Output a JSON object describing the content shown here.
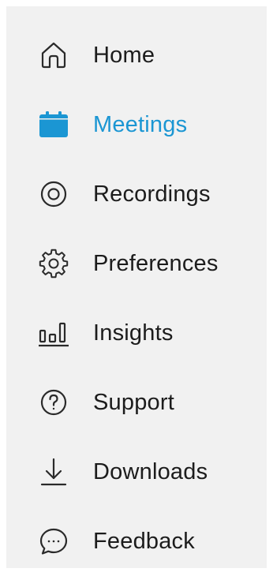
{
  "colors": {
    "active": "#1b96d3",
    "text": "#1c1c1c",
    "sidebar_bg": "#f1f1f1"
  },
  "sidebar": {
    "active_item": "Meetings",
    "items": [
      {
        "label": "Home",
        "icon": "home-icon"
      },
      {
        "label": "Meetings",
        "icon": "calendar-icon"
      },
      {
        "label": "Recordings",
        "icon": "record-icon"
      },
      {
        "label": "Preferences",
        "icon": "gear-icon"
      },
      {
        "label": "Insights",
        "icon": "bar-chart-icon"
      },
      {
        "label": "Support",
        "icon": "help-icon"
      },
      {
        "label": "Downloads",
        "icon": "download-icon"
      },
      {
        "label": "Feedback",
        "icon": "chat-bubble-icon"
      }
    ]
  }
}
